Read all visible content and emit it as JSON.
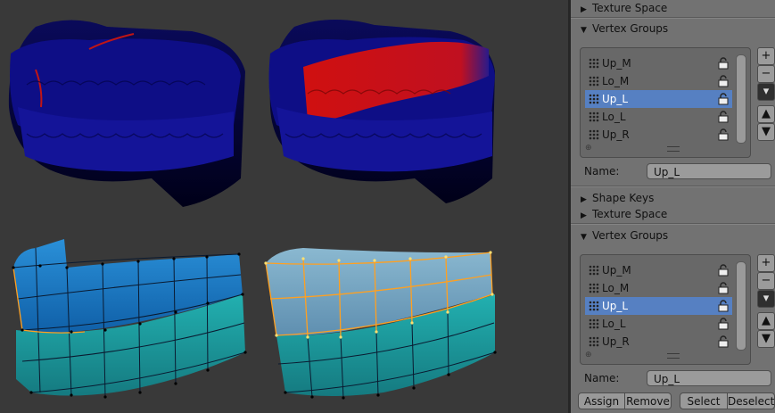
{
  "panel": {
    "texture_space_top": "Texture Space",
    "vertex_groups_top": "Vertex Groups",
    "groups_top": [
      {
        "label": "Up_M",
        "selected": false
      },
      {
        "label": "Lo_M",
        "selected": false
      },
      {
        "label": "Up_L",
        "selected": true
      },
      {
        "label": "Lo_L",
        "selected": false
      },
      {
        "label": "Up_R",
        "selected": false
      }
    ],
    "name_label_top": "Name:",
    "name_value_top": "Up_L",
    "shape_keys": "Shape Keys",
    "texture_space_bottom": "Texture Space",
    "vertex_groups_bottom": "Vertex Groups",
    "groups_bottom": [
      {
        "label": "Up_M",
        "selected": false
      },
      {
        "label": "Lo_M",
        "selected": false
      },
      {
        "label": "Up_L",
        "selected": true
      },
      {
        "label": "Lo_L",
        "selected": false
      },
      {
        "label": "Up_R",
        "selected": false
      }
    ],
    "name_label_bottom": "Name:",
    "name_value_bottom": "Up_L",
    "buttons": {
      "assign": "Assign",
      "remove": "Remove",
      "select": "Select",
      "deselect": "Deselect"
    },
    "side_icons": [
      "plus-icon",
      "minus-icon",
      "menu-down-icon",
      "arrow-up-icon",
      "arrow-down-icon"
    ]
  },
  "colors": {
    "viewport_bg": "#393939",
    "panel_bg": "#727272",
    "selection": "#5680c2",
    "weight_zero": "#0a0a7a",
    "weight_full": "#e01010",
    "mesh_blue": "#1b76c0",
    "mesh_teal": "#1a9a9e",
    "mesh_selected_edge": "#ffa020"
  }
}
